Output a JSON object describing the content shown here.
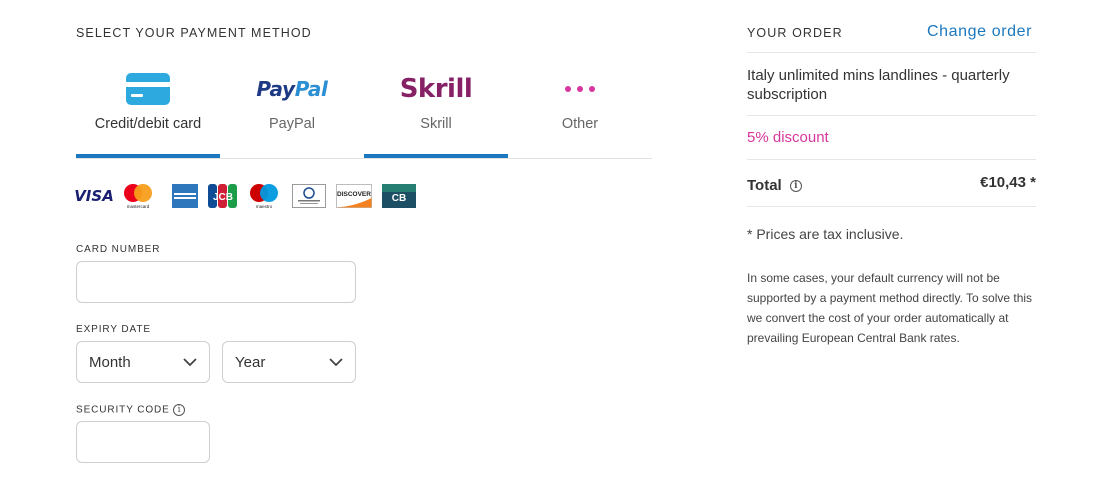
{
  "payment": {
    "section_title": "SELECT YOUR PAYMENT METHOD",
    "tabs": [
      {
        "label": "Credit/debit card",
        "icon": "credit-card-icon"
      },
      {
        "label": "PayPal",
        "icon": "paypal-logo",
        "logo_a": "Pay",
        "logo_b": "Pal"
      },
      {
        "label": "Skrill",
        "icon": "skrill-logo",
        "logo": "Skrill"
      },
      {
        "label": "Other",
        "icon": "more-dots-icon"
      }
    ],
    "active_tab": "Credit/debit card",
    "card_logos": [
      "visa",
      "mastercard",
      "american-express",
      "jcb",
      "maestro",
      "diners-club",
      "discover",
      "cb"
    ],
    "card_logo_text": {
      "visa": "VISA",
      "mastercard": "mastercard",
      "maestro": "maestro",
      "jcb": "JCB",
      "discover": "DISCOVER",
      "cb": "CB"
    },
    "card_number": {
      "label": "CARD NUMBER",
      "value": ""
    },
    "expiry": {
      "label": "EXPIRY DATE",
      "month": "Month",
      "year": "Year"
    },
    "security_code": {
      "label": "SECURITY CODE",
      "value": ""
    }
  },
  "order": {
    "title": "YOUR ORDER",
    "change_link": "Change order",
    "product": "Italy unlimited mins landlines - quarterly subscription",
    "discount": "5% discount",
    "total_label": "Total",
    "total_value": "€10,43 *",
    "tax_note": "* Prices are tax inclusive.",
    "currency_note": "In some cases, your default currency will not be supported by a payment method directly. To solve this we convert the cost of your order automatically at prevailing European Central Bank rates."
  },
  "colors": {
    "accent": "#1b78bf",
    "discount": "#d6379f",
    "card_icon": "#2ea9e0",
    "skrill": "#862165"
  }
}
